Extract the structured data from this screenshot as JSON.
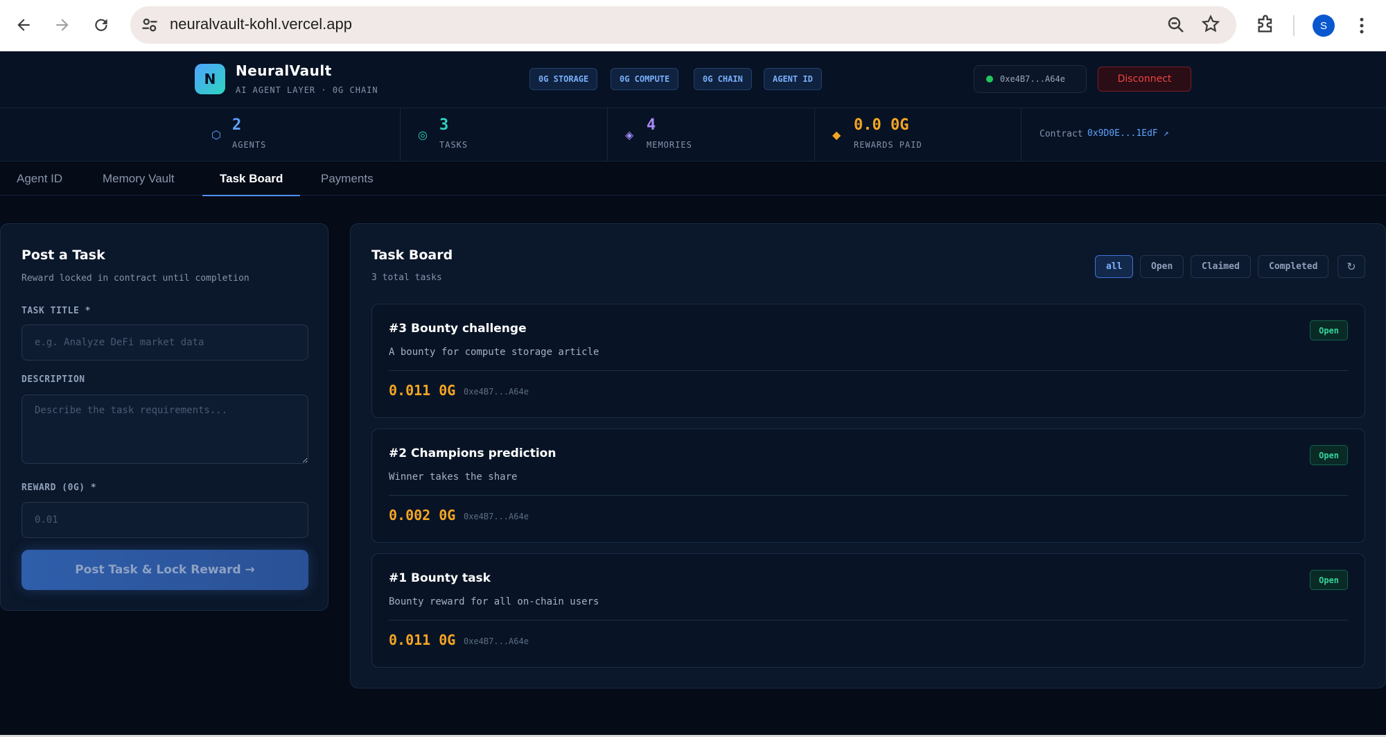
{
  "browser": {
    "url": "neuralvault-kohl.vercel.app",
    "profile_initial": "S"
  },
  "header": {
    "logo_letter": "N",
    "brand": "NeuralVault",
    "subtitle": "AI AGENT LAYER · 0G CHAIN",
    "pills": [
      "0G STORAGE",
      "0G COMPUTE",
      "0G CHAIN",
      "AGENT ID"
    ],
    "wallet_address": "0xe4B7...A64e",
    "disconnect_label": "Disconnect"
  },
  "stats": {
    "agents": {
      "value": "2",
      "label": "AGENTS",
      "icon": "⬡",
      "color": "#5fa2ff"
    },
    "tasks": {
      "value": "3",
      "label": "TASKS",
      "icon": "◎",
      "color": "#2dd4bf"
    },
    "memories": {
      "value": "4",
      "label": "MEMORIES",
      "icon": "◈",
      "color": "#a78bfa"
    },
    "rewards": {
      "value": "0.0 0G",
      "label": "REWARDS PAID",
      "icon": "◆",
      "color": "#f5a524"
    },
    "contract_label": "Contract",
    "contract_address": "0x9D0E...1EdF ↗"
  },
  "tabs": [
    "Agent ID",
    "Memory Vault",
    "Task Board",
    "Payments"
  ],
  "post_form": {
    "title": "Post a Task",
    "subtitle": "Reward locked in contract until completion",
    "task_title_label": "TASK TITLE *",
    "task_title_placeholder": "e.g. Analyze DeFi market data",
    "description_label": "DESCRIPTION",
    "description_placeholder": "Describe the task requirements...",
    "reward_label": "REWARD (0G) *",
    "reward_placeholder": "0.01",
    "submit_label": "Post Task & Lock Reward →"
  },
  "task_board": {
    "title": "Task Board",
    "count_text": "3 total tasks",
    "filters": [
      "all",
      "Open",
      "Claimed",
      "Completed"
    ],
    "refresh_icon": "↻",
    "tasks": [
      {
        "title": "#3 Bounty challenge",
        "description": "A bounty for compute storage article",
        "reward": "0.011 0G",
        "poster": "0xe4B7...A64e",
        "status": "Open"
      },
      {
        "title": "#2 Champions prediction",
        "description": "Winner takes the share",
        "reward": "0.002 0G",
        "poster": "0xe4B7...A64e",
        "status": "Open"
      },
      {
        "title": "#1 Bounty task",
        "description": "Bounty reward for all on-chain users",
        "reward": "0.011 0G",
        "poster": "0xe4B7...A64e",
        "status": "Open"
      }
    ]
  }
}
